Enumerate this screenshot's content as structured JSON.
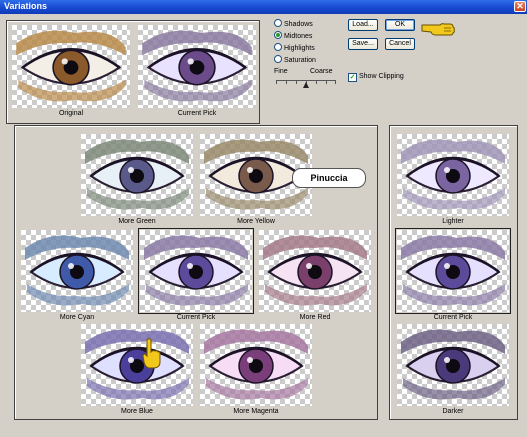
{
  "window": {
    "title": "Variations",
    "close_glyph": "✕"
  },
  "top_previews": {
    "original": "Original",
    "current_pick": "Current Pick"
  },
  "tone_options": [
    {
      "label": "Shadows",
      "selected": false
    },
    {
      "label": "Midtones",
      "selected": true
    },
    {
      "label": "Highlights",
      "selected": false
    },
    {
      "label": "Saturation",
      "selected": false
    }
  ],
  "buttons": {
    "load": "Load...",
    "ok": "OK",
    "save": "Save...",
    "cancel": "Cancel"
  },
  "slider": {
    "fine": "Fine",
    "coarse": "Coarse",
    "value_fraction": 0.5
  },
  "show_clipping": {
    "label": "Show Clipping",
    "checked": true
  },
  "color_grid": {
    "more_green": "More Green",
    "more_yellow": "More Yellow",
    "more_cyan": "More Cyan",
    "current_pick": "Current Pick",
    "more_red": "More Red",
    "more_blue": "More Blue",
    "more_magenta": "More Magenta"
  },
  "brightness": {
    "lighter": "Lighter",
    "current_pick": "Current Pick",
    "darker": "Darker"
  },
  "watermark": "Pinuccia",
  "tints": {
    "original": {
      "sclera": "#f3efe6",
      "iris": "#8a5a2a",
      "frame": "#b98a4a"
    },
    "current_top": {
      "sclera": "#e9e2ff",
      "iris": "#6b4b8a",
      "frame": "#8a7aa0"
    },
    "more_green": {
      "sclera": "#e6f0f6",
      "iris": "#5a5a8a",
      "frame": "#7d8a7a"
    },
    "more_yellow": {
      "sclera": "#f2eadc",
      "iris": "#7a5a4a",
      "frame": "#9a8a6a"
    },
    "more_cyan": {
      "sclera": "#d8ecff",
      "iris": "#3f5aa8",
      "frame": "#6e8ab0"
    },
    "current_mid": {
      "sclera": "#e6e0ff",
      "iris": "#5c4a9a",
      "frame": "#8a7aa5"
    },
    "more_red": {
      "sclera": "#f5e2f2",
      "iris": "#7a3f6a",
      "frame": "#a57a8a"
    },
    "more_blue": {
      "sclera": "#dfe0ff",
      "iris": "#4a3f9a",
      "frame": "#7a70b0"
    },
    "more_magenta": {
      "sclera": "#f7dcf6",
      "iris": "#7a3f7a",
      "frame": "#a577a0"
    },
    "lighter": {
      "sclera": "#efe9ff",
      "iris": "#7a65a0",
      "frame": "#a095b8"
    },
    "current_right": {
      "sclera": "#e6e0ff",
      "iris": "#5c4a9a",
      "frame": "#8a7aa5"
    },
    "darker": {
      "sclera": "#d9d0f0",
      "iris": "#4b3a7a",
      "frame": "#6e6385"
    }
  }
}
